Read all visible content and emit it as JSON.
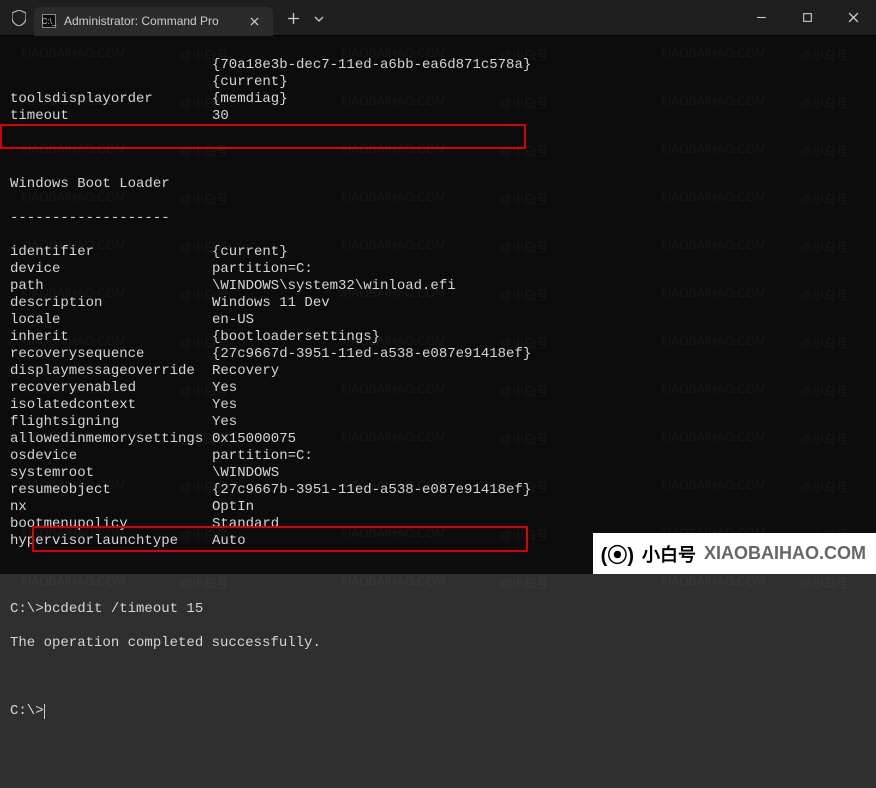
{
  "window": {
    "title": "Administrator: Command Pro",
    "tab_icon_text": "C:\\_"
  },
  "terminal": {
    "pre_rows": [
      {
        "key": "",
        "val": "{70a18e3b-dec7-11ed-a6bb-ea6d871c578a}"
      },
      {
        "key": "",
        "val": "{current}"
      },
      {
        "key": "toolsdisplayorder",
        "val": "{memdiag}"
      },
      {
        "key": "timeout",
        "val": "30"
      }
    ],
    "section_title": "Windows Boot Loader",
    "section_rule": "-------------------",
    "loader_rows": [
      {
        "key": "identifier",
        "val": "{current}"
      },
      {
        "key": "device",
        "val": "partition=C:"
      },
      {
        "key": "path",
        "val": "\\WINDOWS\\system32\\winload.efi"
      },
      {
        "key": "description",
        "val": "Windows 11 Dev"
      },
      {
        "key": "locale",
        "val": "en-US"
      },
      {
        "key": "inherit",
        "val": "{bootloadersettings}"
      },
      {
        "key": "recoverysequence",
        "val": "{27c9667d-3951-11ed-a538-e087e91418ef}"
      },
      {
        "key": "displaymessageoverride",
        "val": "Recovery"
      },
      {
        "key": "recoveryenabled",
        "val": "Yes"
      },
      {
        "key": "isolatedcontext",
        "val": "Yes"
      },
      {
        "key": "flightsigning",
        "val": "Yes"
      },
      {
        "key": "allowedinmemorysettings",
        "val": "0x15000075"
      },
      {
        "key": "osdevice",
        "val": "partition=C:"
      },
      {
        "key": "systemroot",
        "val": "\\WINDOWS"
      },
      {
        "key": "resumeobject",
        "val": "{27c9667b-3951-11ed-a538-e087e91418ef}"
      },
      {
        "key": "nx",
        "val": "OptIn"
      },
      {
        "key": "bootmenupolicy",
        "val": "Standard"
      },
      {
        "key": "hypervisorlaunchtype",
        "val": "Auto"
      }
    ],
    "cmd1_prompt": "C:\\>",
    "cmd1_input": "bcdedit /timeout 15",
    "cmd1_result": "The operation completed successfully.",
    "cmd2_prompt": "C:\\>"
  },
  "badge": {
    "cn": "小白号",
    "site": "XIAOBAIHAO.COM"
  },
  "watermark": {
    "a": "@小白号",
    "b": "XIAOBAIHAO.COM"
  }
}
